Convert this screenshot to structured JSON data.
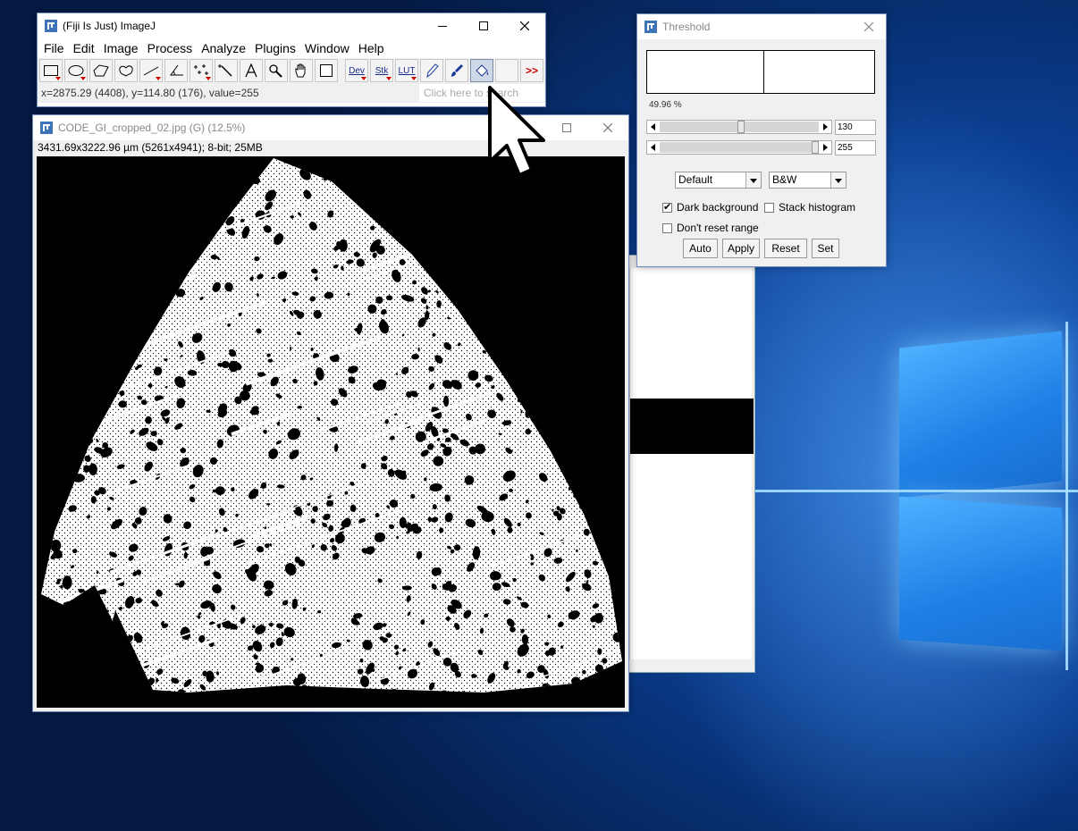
{
  "main_window": {
    "title": "(Fiji Is Just) ImageJ",
    "menu": [
      "File",
      "Edit",
      "Image",
      "Process",
      "Analyze",
      "Plugins",
      "Window",
      "Help"
    ],
    "tools": [
      {
        "name": "rectangle-tool-icon"
      },
      {
        "name": "oval-tool-icon"
      },
      {
        "name": "polygon-tool-icon"
      },
      {
        "name": "freehand-tool-icon"
      },
      {
        "name": "line-tool-icon"
      },
      {
        "name": "angle-tool-icon"
      },
      {
        "name": "multipoint-tool-icon"
      },
      {
        "name": "wand-tool-icon"
      },
      {
        "name": "text-tool-icon"
      },
      {
        "name": "magnifier-tool-icon"
      },
      {
        "name": "hand-tool-icon"
      },
      {
        "name": "color-picker-tool-icon"
      }
    ],
    "text_tools": {
      "dev": "Dev",
      "stk": "Stk",
      "lut": "LUT",
      "more": ">>"
    },
    "status": "x=2875.29 (4408), y=114.80 (176), value=255",
    "search_placeholder": "Click here to search"
  },
  "image_window": {
    "title": "CODE_GI_cropped_02.jpg (G) (12.5%)",
    "info": "3431.69x3222.96 µm (5261x4941); 8-bit; 25MB"
  },
  "threshold": {
    "title": "Threshold",
    "percent": "49.96 %",
    "lower_value": "130",
    "upper_value": "255",
    "lower_fraction": 0.51,
    "upper_fraction": 1.0,
    "method": "Default",
    "display": "B&W",
    "dark_background": {
      "label": "Dark background",
      "checked": true
    },
    "stack_histogram": {
      "label": "Stack histogram",
      "checked": false
    },
    "dont_reset_range": {
      "label": "Don't reset range",
      "checked": false
    },
    "buttons": {
      "auto": "Auto",
      "apply": "Apply",
      "reset": "Reset",
      "set": "Set"
    }
  }
}
